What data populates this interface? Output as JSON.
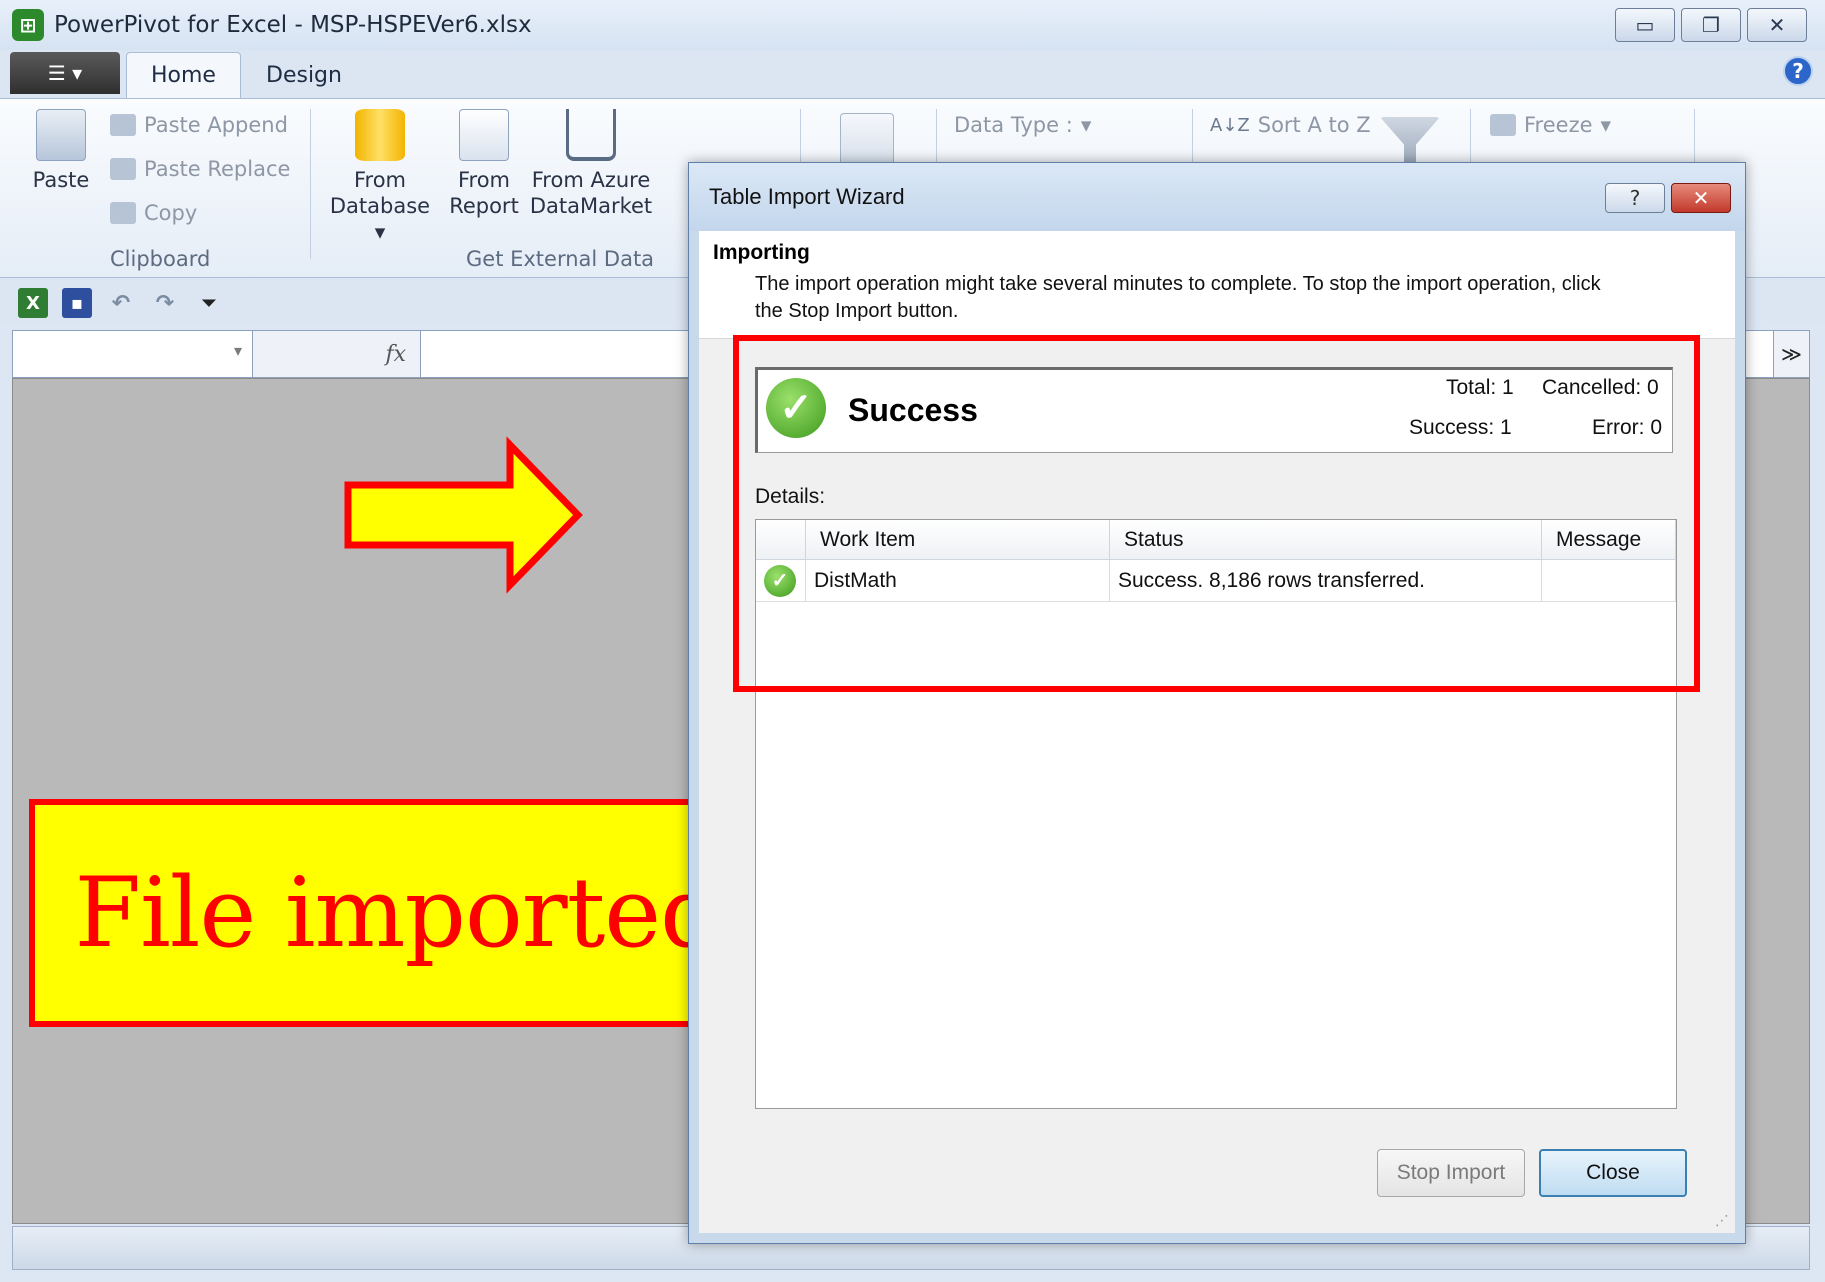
{
  "window": {
    "title": "PowerPivot for Excel - MSP-HSPEVer6.xlsx",
    "app_icon": "powerpivot-icon",
    "controls": [
      "minimize-icon",
      "restore-icon",
      "close-icon"
    ]
  },
  "ribbon": {
    "tabs": [
      {
        "label": "Home"
      },
      {
        "label": "Design"
      }
    ],
    "clipboard": {
      "paste": "Paste",
      "paste_append": "Paste Append",
      "paste_replace": "Paste Replace",
      "copy": "Copy",
      "group_label": "Clipboard"
    },
    "external": {
      "from_database_1": "From",
      "from_database_2": "Database",
      "from_report_1": "From",
      "from_report_2": "Report",
      "from_azure_1": "From Azure",
      "from_azure_2": "DataMarket",
      "group_label": "Get External Data"
    },
    "data_type": "Data Type :",
    "sort": "Sort A to Z",
    "freeze": "Freeze"
  },
  "formula_bar": {
    "fx": "fx"
  },
  "annotation": {
    "callout_text": "File imported",
    "colors": {
      "callout_bg": "#ffff00",
      "callout_border": "#ff0000",
      "arrow_fill": "#ffff00"
    }
  },
  "dialog": {
    "title": "Table Import Wizard",
    "help_label": "?",
    "close_label": "✕",
    "header_title": "Importing",
    "header_desc": "The import operation might take several minutes to complete. To stop the import operation, click the Stop Import button.",
    "result": {
      "status": "Success",
      "total": "Total: 1",
      "cancelled": "Cancelled: 0",
      "success": "Success: 1",
      "error": "Error: 0"
    },
    "details_label": "Details:",
    "columns": [
      "Work Item",
      "Status",
      "Message"
    ],
    "rows": [
      {
        "work_item": "DistMath",
        "status": "Success. 8,186 rows transferred.",
        "message": ""
      }
    ],
    "buttons": {
      "stop": "Stop Import",
      "close": "Close"
    }
  }
}
